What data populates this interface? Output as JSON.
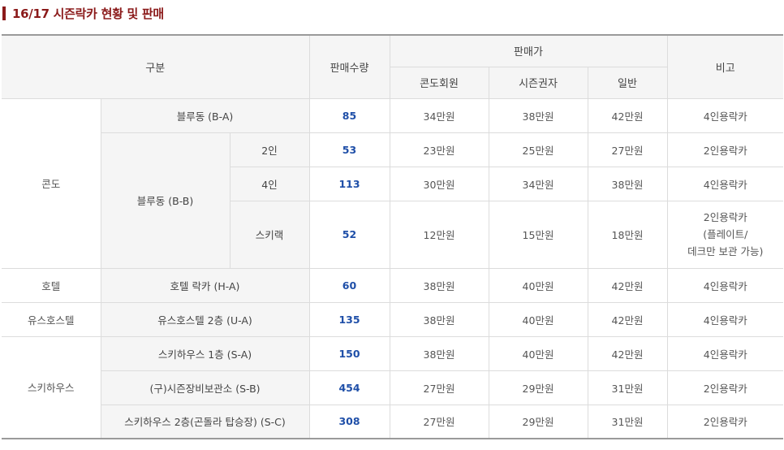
{
  "title": "16/17 시즌락카 현황 및 판매",
  "header": {
    "category": "구분",
    "quantity": "판매수량",
    "price": "판매가",
    "price_cols": [
      "콘도회원",
      "시즌권자",
      "일반"
    ],
    "note": "비고"
  },
  "rows": {
    "condo": {
      "group": "콘도",
      "ba": {
        "name": "블루동 (B-A)",
        "qty": "85",
        "prices": [
          "34만원",
          "38만원",
          "42만원"
        ],
        "note": "4인용락카"
      },
      "bb": {
        "name": "블루동 (B-B)",
        "r2": {
          "sub": "2인",
          "qty": "53",
          "prices": [
            "23만원",
            "25만원",
            "27만원"
          ],
          "note": "2인용락카"
        },
        "r4": {
          "sub": "4인",
          "qty": "113",
          "prices": [
            "30만원",
            "34만원",
            "38만원"
          ],
          "note": "4인용락카"
        },
        "ski": {
          "sub": "스키랙",
          "qty": "52",
          "prices": [
            "12만원",
            "15만원",
            "18만원"
          ],
          "note_lines": [
            "2인용락카",
            "(플레이트/",
            "데크만 보관 가능)"
          ]
        }
      }
    },
    "hotel": {
      "group": "호텔",
      "name": "호텔 락카 (H-A)",
      "qty": "60",
      "prices": [
        "38만원",
        "40만원",
        "42만원"
      ],
      "note": "4인용락카"
    },
    "youth": {
      "group": "유스호스텔",
      "name": "유스호스텔 2층 (U-A)",
      "qty": "135",
      "prices": [
        "38만원",
        "40만원",
        "42만원"
      ],
      "note": "4인용락카"
    },
    "skihouse": {
      "group": "스키하우스",
      "sa": {
        "name": "스키하우스 1층 (S-A)",
        "qty": "150",
        "prices": [
          "38만원",
          "40만원",
          "42만원"
        ],
        "note": "4인용락카"
      },
      "sb": {
        "name": "(구)시즌장비보관소 (S-B)",
        "qty": "454",
        "prices": [
          "27만원",
          "29만원",
          "31만원"
        ],
        "note": "2인용락카"
      },
      "sc": {
        "name": "스키하우스 2층(곤돌라 탑승장) (S-C)",
        "qty": "308",
        "prices": [
          "27만원",
          "29만원",
          "31만원"
        ],
        "note": "2인용락카"
      }
    }
  }
}
